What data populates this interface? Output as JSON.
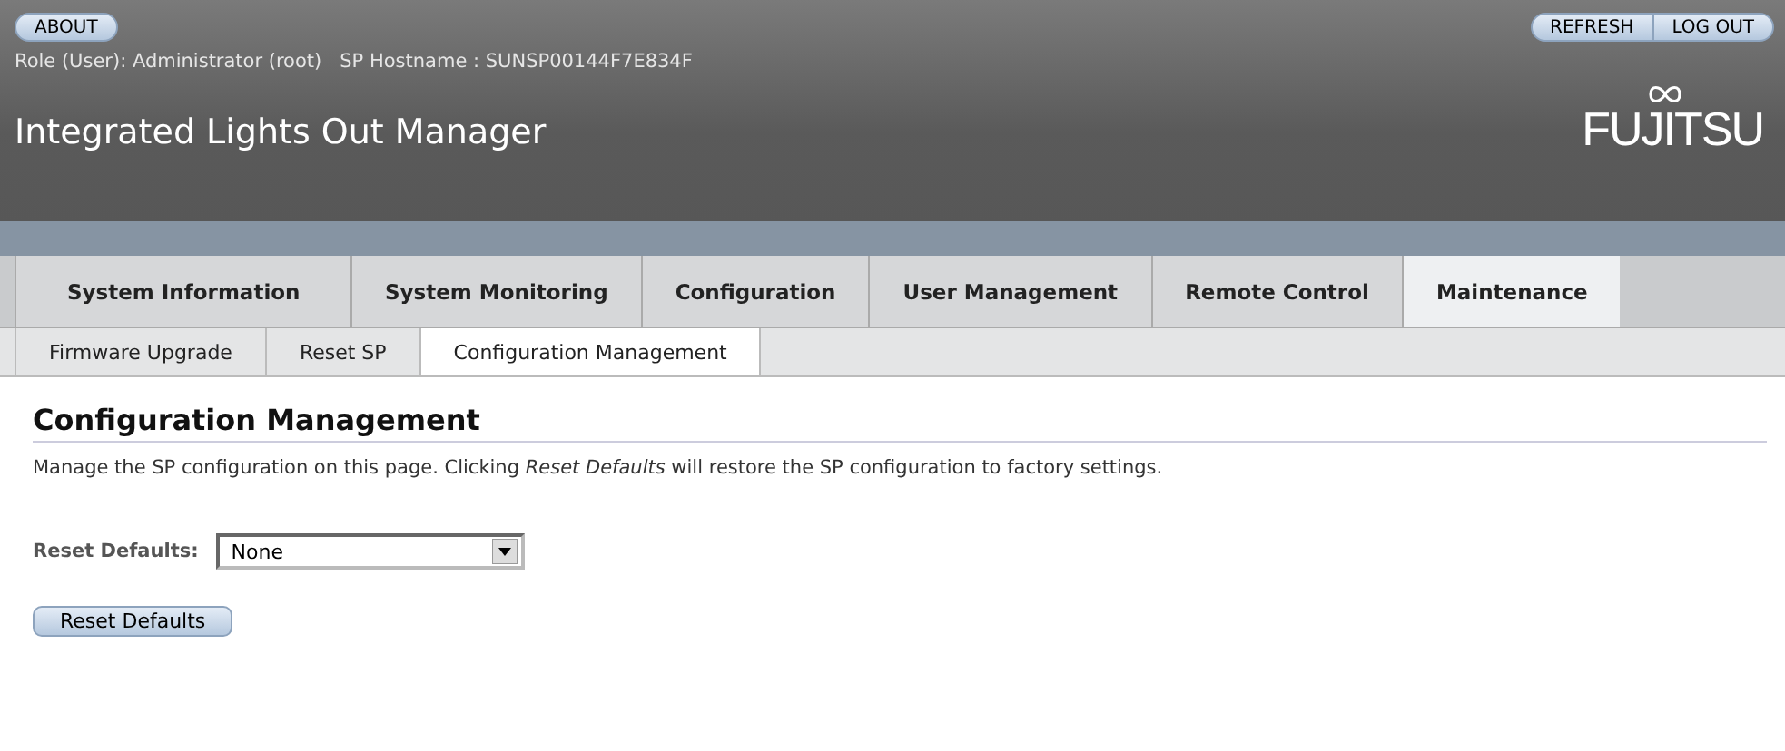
{
  "header": {
    "about_button": "ABOUT",
    "actions": [
      "REFRESH",
      "LOG OUT"
    ],
    "role_line": "Role (User): Administrator (root)   SP Hostname : SUNSP00144F7E834F",
    "title": "Integrated Lights Out Manager",
    "logo": "FUJITSU"
  },
  "tabs": [
    {
      "label": "System Information",
      "selected": false
    },
    {
      "label": "System Monitoring",
      "selected": false
    },
    {
      "label": "Configuration",
      "selected": false
    },
    {
      "label": "User Management",
      "selected": false
    },
    {
      "label": "Remote Control",
      "selected": false
    },
    {
      "label": "Maintenance",
      "selected": true
    }
  ],
  "subtabs": [
    {
      "label": "Firmware Upgrade",
      "selected": false
    },
    {
      "label": "Reset SP",
      "selected": false
    },
    {
      "label": "Configuration Management",
      "selected": true
    }
  ],
  "page": {
    "heading": "Configuration Management",
    "description": "Manage the SP configuration on this page. Clicking *Reset Defaults* will restore the SP configuration to factory settings.",
    "field_label": "Reset Defaults:",
    "select_value": "None",
    "button": "Reset Defaults"
  }
}
